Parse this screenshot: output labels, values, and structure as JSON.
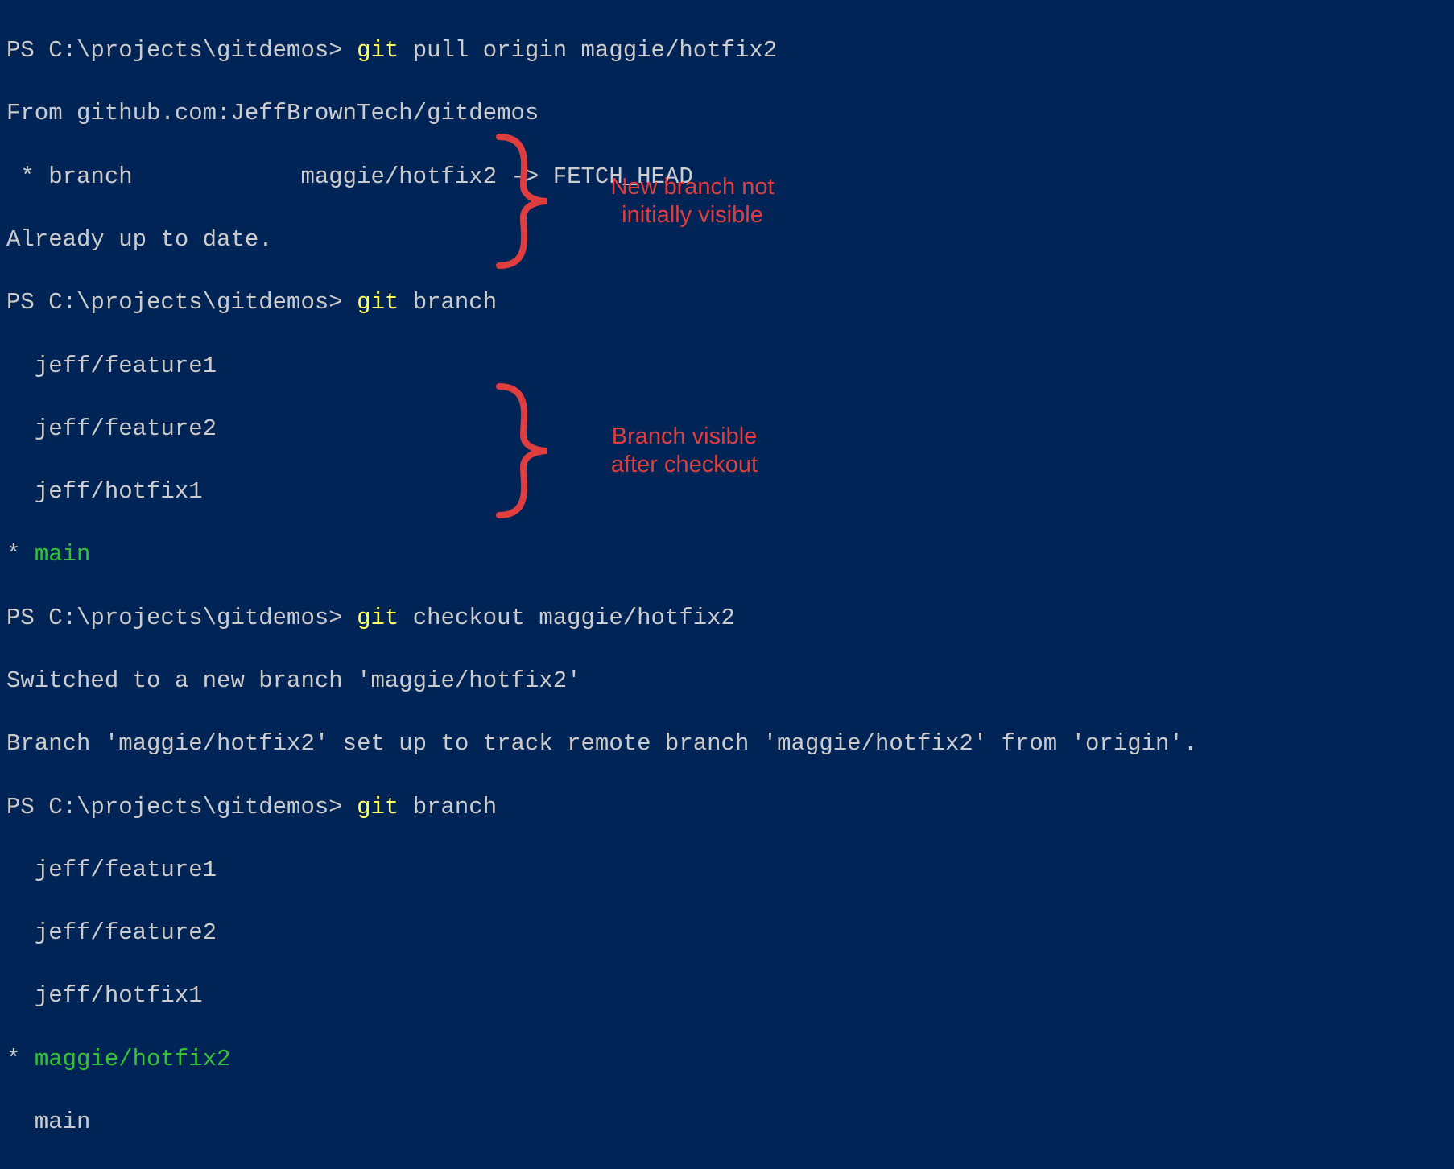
{
  "l1_prompt": "PS C:\\projects\\gitdemos> ",
  "l1_cmd": "git",
  "l1_rest": " pull origin maggie/hotfix2",
  "l2": "From github.com:JeffBrownTech/gitdemos",
  "l3": " * branch            maggie/hotfix2 -> FETCH_HEAD",
  "l4": "Already up to date.",
  "l5_prompt": "PS C:\\projects\\gitdemos> ",
  "l5_cmd": "git",
  "l5_rest": " branch",
  "l6": "  jeff/feature1",
  "l7": "  jeff/feature2",
  "l8": "  jeff/hotfix1",
  "l9_star": "* ",
  "l9_branch": "main",
  "l10_prompt": "PS C:\\projects\\gitdemos> ",
  "l10_cmd": "git",
  "l10_rest": " checkout maggie/hotfix2",
  "l11": "Switched to a new branch 'maggie/hotfix2'",
  "l12": "Branch 'maggie/hotfix2' set up to track remote branch 'maggie/hotfix2' from 'origin'.",
  "l13_prompt": "PS C:\\projects\\gitdemos> ",
  "l13_cmd": "git",
  "l13_rest": " branch",
  "l14": "  jeff/feature1",
  "l15": "  jeff/feature2",
  "l16": "  jeff/hotfix1",
  "l17_star": "* ",
  "l17_branch": "maggie/hotfix2",
  "l18": "  main",
  "annotation1": "New branch not\ninitially visible",
  "annotation2": "Branch visible\nafter checkout"
}
